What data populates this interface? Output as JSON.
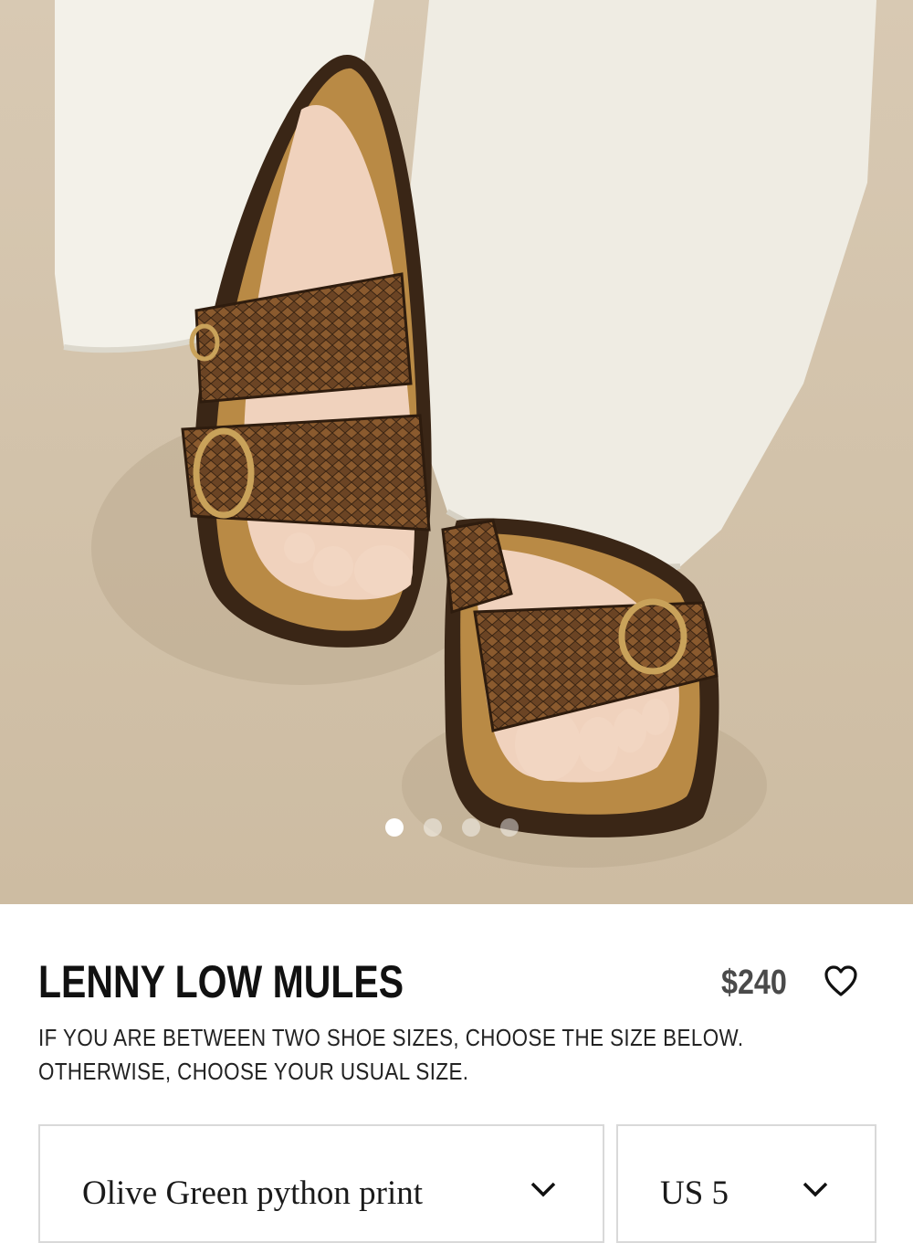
{
  "product": {
    "title": "LENNY LOW MULES",
    "price": "$240",
    "size_note": "IF YOU ARE BETWEEN TWO SHOE SIZES, CHOOSE THE SIZE BELOW. OTHERWISE, CHOOSE YOUR USUAL SIZE."
  },
  "gallery": {
    "image_count": 4,
    "active_index": 0
  },
  "options": {
    "color_selected": "Olive Green python print",
    "size_selected": "US 5"
  },
  "icons": {
    "wishlist": "heart-icon",
    "dropdown": "chevron-down-icon"
  },
  "colors": {
    "text": "#111111",
    "price": "#4a4a4a",
    "border": "#d9d9d9",
    "backdrop": "#d6c6ae"
  }
}
